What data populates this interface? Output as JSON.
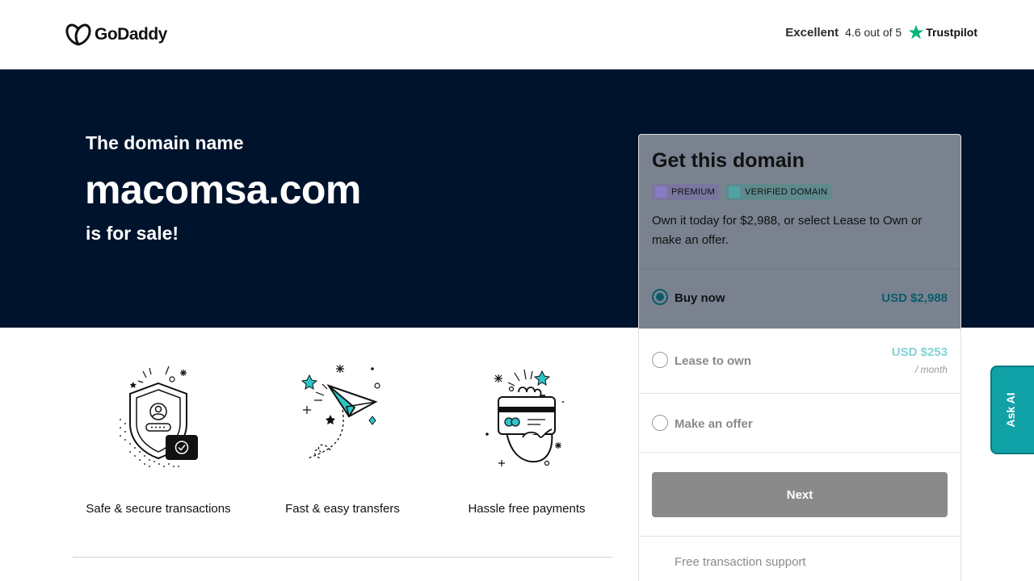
{
  "header": {
    "logo_text": "GoDaddy",
    "trust_rating_word": "Excellent",
    "trust_score": "4.6 out of 5",
    "trust_brand": "Trustpilot"
  },
  "hero": {
    "subtitle": "The domain name",
    "domain": "macomsa.com",
    "sale_text": "is for sale!"
  },
  "features": [
    {
      "label": "Safe & secure transactions",
      "icon": "shield-icon"
    },
    {
      "label": "Fast & easy transfers",
      "icon": "paper-plane-icon"
    },
    {
      "label": "Hassle free payments",
      "icon": "credit-card-hand-icon"
    }
  ],
  "card": {
    "title": "Get this domain",
    "badges": [
      "PREMIUM",
      "VERIFIED DOMAIN"
    ],
    "description": "Own it today for $2,988, or select Lease to Own or make an offer.",
    "options": [
      {
        "label": "Buy now",
        "price": "USD $2,988",
        "selected": true
      },
      {
        "label": "Lease to own",
        "price": "USD $253",
        "per": "/ month",
        "selected": false
      },
      {
        "label": "Make an offer",
        "selected": false
      }
    ],
    "next_label": "Next",
    "support_label": "Free transaction support"
  },
  "ask_ai": {
    "label": "Ask AI"
  },
  "colors": {
    "hero_bg": "#00132c",
    "accent_teal": "#10a2a6",
    "buy_price": "#0a5c6a",
    "lease_price": "#7fd4d6"
  }
}
